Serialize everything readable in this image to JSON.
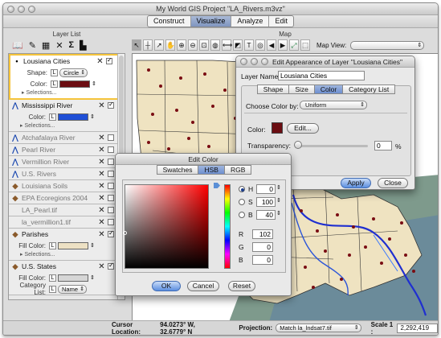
{
  "window": {
    "title": "My World GIS Project \"LA_Rivers.m3vz\""
  },
  "modes": [
    {
      "label": "Construct",
      "active": false
    },
    {
      "label": "Visualize",
      "active": true
    },
    {
      "label": "Analyze",
      "active": false
    },
    {
      "label": "Edit",
      "active": false
    }
  ],
  "layer_panel": {
    "title": "Layer List",
    "tool_icons": [
      "open-book-icon",
      "edit-layer-icon",
      "table-icon",
      "remove-icon",
      "sum-icon",
      "chart-icon"
    ],
    "layers": [
      {
        "name": "Lousiana Cities",
        "icon": "point-icon",
        "visible": true,
        "selected": true,
        "props": [
          {
            "label": "Shape:",
            "value": "Circle"
          },
          {
            "label": "Color:",
            "color": "#6b0d12"
          }
        ],
        "selections": "Selections..."
      },
      {
        "name": "Mississippi River",
        "icon": "line-icon",
        "visible": true,
        "props": [
          {
            "label": "Color:",
            "color": "#1f4fd6"
          }
        ],
        "selections": "Selections..."
      },
      {
        "name": "Atchafalaya River",
        "icon": "line-icon",
        "visible": false
      },
      {
        "name": "Pearl River",
        "icon": "line-icon",
        "visible": false
      },
      {
        "name": "Vermillion River",
        "icon": "line-icon",
        "visible": false
      },
      {
        "name": "U.S. Rivers",
        "icon": "line-icon",
        "visible": false
      },
      {
        "name": "Louisiana Soils",
        "icon": "polygon-icon",
        "visible": false
      },
      {
        "name": "EPA Ecoregions 2004",
        "icon": "polygon-icon",
        "visible": false
      },
      {
        "name": "LA_Pearl.tif",
        "icon": "",
        "visible": false
      },
      {
        "name": "la_vermillion1.tif",
        "icon": "",
        "visible": false
      },
      {
        "name": "Parishes",
        "icon": "polygon-icon",
        "visible": true,
        "props": [
          {
            "label": "Fill Color:",
            "color": "#ede1c4"
          }
        ],
        "selections": "Selections..."
      },
      {
        "name": "U.S. States",
        "icon": "polygon-icon",
        "visible": true,
        "props": [
          {
            "label": "Fill Color:",
            "color": "#d6d6d6"
          },
          {
            "label": "Category List:",
            "value": "Name"
          }
        ]
      }
    ]
  },
  "map_panel": {
    "title": "Map",
    "map_view_label": "Map View:",
    "tool_icons": [
      "pointer-icon",
      "cross-icon",
      "arrow-icon",
      "hand-icon",
      "zoom-in-icon",
      "zoom-out-icon",
      "zoom-box-icon",
      "globe-icon",
      "ruler-icon",
      "region-icon",
      "text-icon",
      "buffer-icon",
      "nav-back-icon",
      "nav-forward-icon",
      "fit-icon",
      "select-icon"
    ]
  },
  "status": {
    "cursor_label": "Cursor Location:",
    "cursor_value": "94.0273° W, 32.6779° N",
    "projection_label": "Projection:",
    "projection_value": "Match la_lndsat7.tif",
    "scale_label": "Scale 1 :",
    "scale_value": "2,292,419"
  },
  "edit_appearance": {
    "title": "Edit Appearance of Layer \"Lousiana Cities\"",
    "layer_name_label": "Layer Name:",
    "layer_name_value": "Lousiana Cities",
    "tabs": [
      {
        "label": "Shape",
        "active": false
      },
      {
        "label": "Size",
        "active": false
      },
      {
        "label": "Color",
        "active": true
      },
      {
        "label": "Category List",
        "active": false
      }
    ],
    "choose_color_label": "Choose Color by:",
    "choose_color_value": "Uniform",
    "color_label": "Color:",
    "color_swatch": "#6b0d12",
    "edit_button": "Edit...",
    "transparency_label": "Transparency:",
    "transparency_value": "0",
    "transparency_unit": "%",
    "apply": "Apply",
    "close": "Close"
  },
  "edit_color": {
    "title": "Edit Color",
    "tabs": [
      {
        "label": "Swatches",
        "active": false
      },
      {
        "label": "HSB",
        "active": true
      },
      {
        "label": "RGB",
        "active": false
      }
    ],
    "hsb": [
      {
        "label": "H",
        "value": "0",
        "selected": true
      },
      {
        "label": "S",
        "value": "100",
        "selected": false
      },
      {
        "label": "B",
        "value": "40",
        "selected": false
      }
    ],
    "rgb": [
      {
        "label": "R",
        "value": "102"
      },
      {
        "label": "G",
        "value": "0"
      },
      {
        "label": "B",
        "value": "0"
      }
    ],
    "ok": "OK",
    "cancel": "Cancel",
    "reset": "Reset"
  }
}
